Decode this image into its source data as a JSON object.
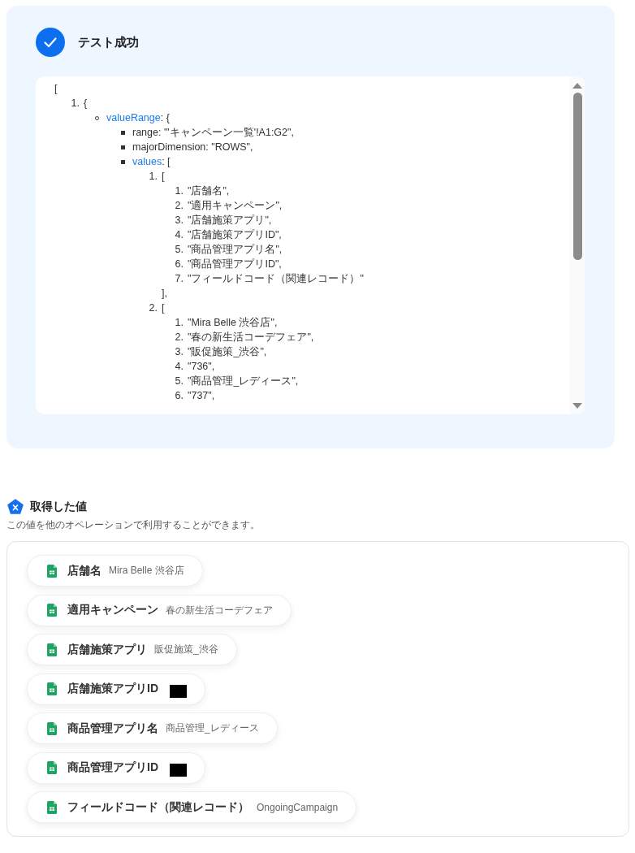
{
  "test_result": {
    "passed": true,
    "title": "テスト成功",
    "output": {
      "text": "[",
      "list": {
        "kind": "ordered",
        "items": [
          {
            "marker": "1.",
            "text": "{",
            "list": {
              "kind": "circle",
              "items": [
                {
                  "key": "valueRange",
                  "text": ": {",
                  "list": {
                    "kind": "square",
                    "items": [
                      {
                        "text": "range: \"'キャンペーン一覧'!A1:G2\","
                      },
                      {
                        "text": "majorDimension: \"ROWS\","
                      },
                      {
                        "key": "values",
                        "text": ": [",
                        "list": {
                          "kind": "ordered",
                          "items": [
                            {
                              "marker": "1.",
                              "text": "[",
                              "list": {
                                "kind": "ordered",
                                "items": [
                                  {
                                    "marker": "1.",
                                    "text": "\"店舗名\","
                                  },
                                  {
                                    "marker": "2.",
                                    "text": "\"適用キャンペーン\","
                                  },
                                  {
                                    "marker": "3.",
                                    "text": "\"店舗施策アプリ\","
                                  },
                                  {
                                    "marker": "4.",
                                    "text": "\"店舗施策アプリID\","
                                  },
                                  {
                                    "marker": "5.",
                                    "text": "\"商品管理アプリ名\","
                                  },
                                  {
                                    "marker": "6.",
                                    "text": "\"商品管理アプリID\","
                                  },
                                  {
                                    "marker": "7.",
                                    "text": "\"フィールドコード（関連レコード）\""
                                  }
                                ]
                              },
                              "closing": "],"
                            },
                            {
                              "marker": "2.",
                              "text": "[",
                              "list": {
                                "kind": "ordered",
                                "items": [
                                  {
                                    "marker": "1.",
                                    "text": "\"Mira Belle 渋谷店\","
                                  },
                                  {
                                    "marker": "2.",
                                    "text": "\"春の新生活コーデフェア\","
                                  },
                                  {
                                    "marker": "3.",
                                    "text": "\"販促施策_渋谷\","
                                  },
                                  {
                                    "marker": "4.",
                                    "text": "\"736\","
                                  },
                                  {
                                    "marker": "5.",
                                    "text": "\"商品管理_レディース\","
                                  },
                                  {
                                    "marker": "6.",
                                    "text": "\"737\","
                                  }
                                ]
                              }
                            }
                          ]
                        }
                      }
                    ]
                  }
                }
              ]
            }
          }
        ]
      }
    }
  },
  "values_section": {
    "title": "取得した値",
    "description": "この値を他のオペレーションで利用することができます。",
    "items": [
      {
        "label": "店舗名",
        "value": "Mira Belle 渋谷店",
        "redacted": false
      },
      {
        "label": "適用キャンペーン",
        "value": "春の新生活コーデフェア",
        "redacted": false
      },
      {
        "label": "店舗施策アプリ",
        "value": "販促施策_渋谷",
        "redacted": false
      },
      {
        "label": "店舗施策アプリID",
        "redacted": true
      },
      {
        "label": "商品管理アプリ名",
        "value": "商品管理_レディース",
        "redacted": false
      },
      {
        "label": "商品管理アプリID",
        "redacted": true
      },
      {
        "label": "フィールドコード（関連レコード）",
        "value": "OngoingCampaign",
        "redacted": false
      }
    ]
  }
}
